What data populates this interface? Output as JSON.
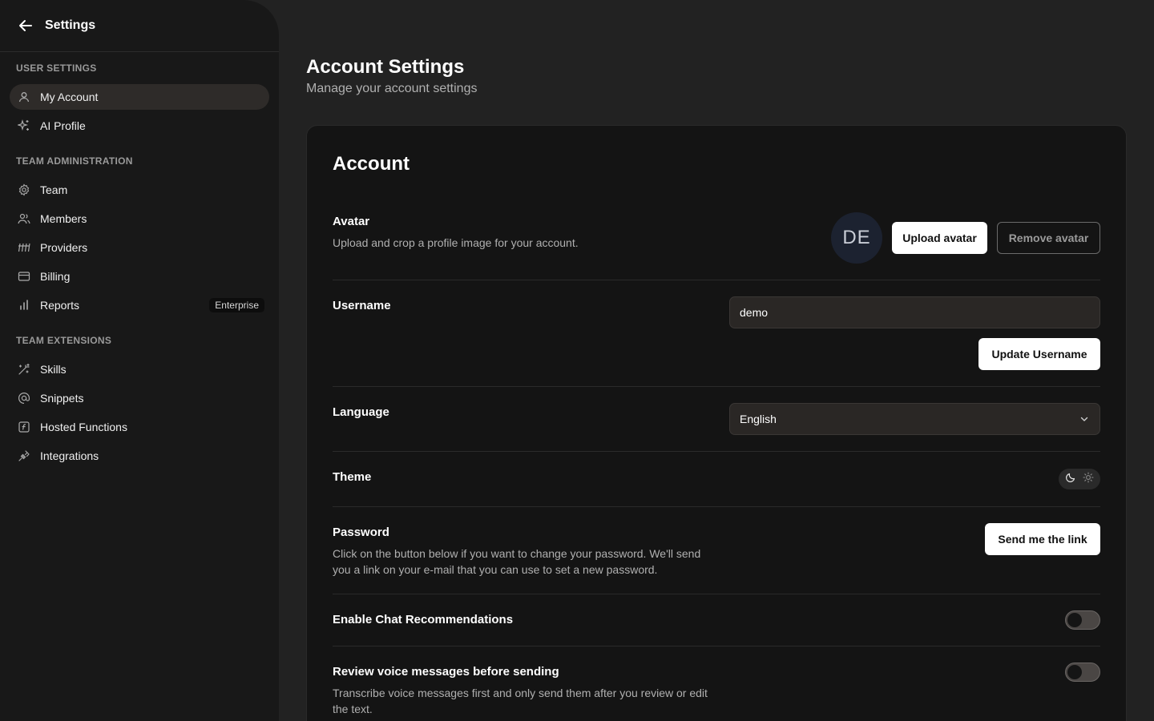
{
  "sidebar": {
    "title": "Settings",
    "sections": [
      {
        "label": "USER SETTINGS"
      },
      {
        "label": "TEAM ADMINISTRATION"
      },
      {
        "label": "TEAM EXTENSIONS"
      }
    ],
    "items": [
      {
        "label": "My Account",
        "icon": "user-icon",
        "active": true
      },
      {
        "label": "AI Profile",
        "icon": "sparkles-icon"
      },
      {
        "label": "Team",
        "icon": "gear-icon"
      },
      {
        "label": "Members",
        "icon": "users-icon"
      },
      {
        "label": "Providers",
        "icon": "providers-icon"
      },
      {
        "label": "Billing",
        "icon": "credit-card-icon"
      },
      {
        "label": "Reports",
        "icon": "bar-chart-icon",
        "badge": "Enterprise"
      },
      {
        "label": "Skills",
        "icon": "magic-wand-icon"
      },
      {
        "label": "Snippets",
        "icon": "at-sign-icon"
      },
      {
        "label": "Hosted Functions",
        "icon": "function-icon"
      },
      {
        "label": "Integrations",
        "icon": "plug-icon"
      }
    ]
  },
  "main": {
    "title": "Account Settings",
    "subtitle": "Manage your account settings"
  },
  "account": {
    "title": "Account",
    "avatar": {
      "label": "Avatar",
      "description": "Upload and crop a profile image for your account.",
      "initials": "DE",
      "upload_label": "Upload avatar",
      "remove_label": "Remove avatar"
    },
    "username": {
      "label": "Username",
      "value": "demo",
      "button": "Update Username"
    },
    "language": {
      "label": "Language",
      "selected": "English"
    },
    "theme": {
      "label": "Theme",
      "options": [
        "dark",
        "light"
      ],
      "selected": "dark"
    },
    "password": {
      "label": "Password",
      "description": "Click on the button below if you want to change your password. We'll send you a link on your e-mail that you can use to set a new password.",
      "button": "Send me the link"
    },
    "chat_recommendations": {
      "label": "Enable Chat Recommendations",
      "enabled": false
    },
    "voice_review": {
      "label": "Review voice messages before sending",
      "description": "Transcribe voice messages first and only send them after you review or edit the text.",
      "enabled": false
    }
  },
  "colors": {
    "background": "#222222",
    "sidebar": "#181818",
    "card": "#141414",
    "active_item": "#2e2b29",
    "primary_button": "#ffffff"
  }
}
